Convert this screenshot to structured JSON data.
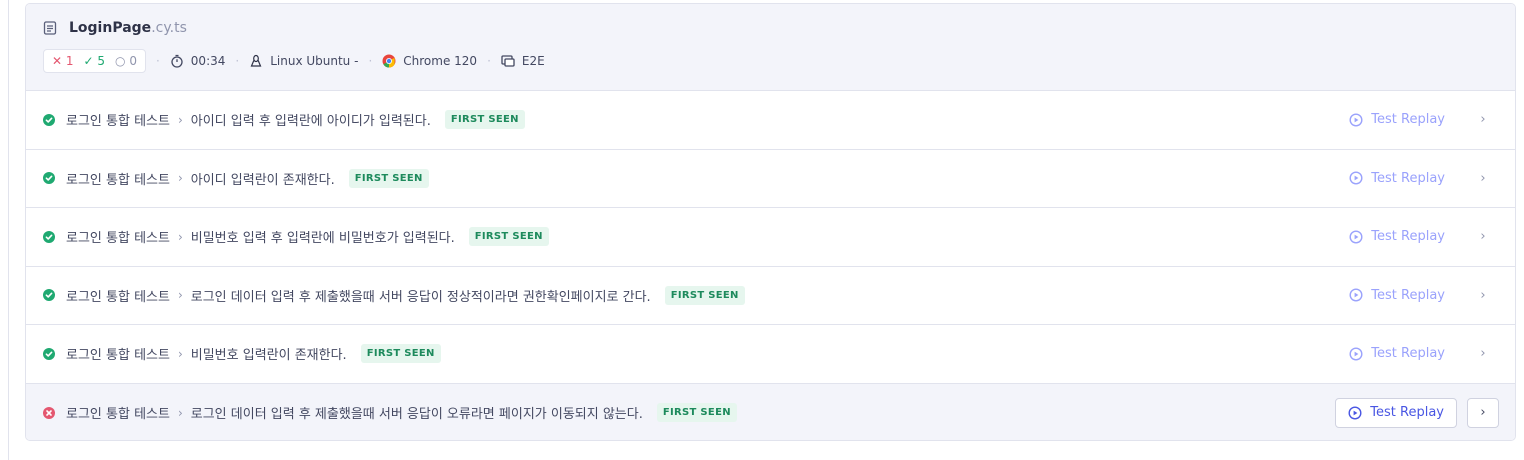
{
  "spec": {
    "name": "LoginPage",
    "ext": ".cy.ts",
    "counts": {
      "failed": "1",
      "passed": "5",
      "pending": "0"
    },
    "duration": "00:34",
    "os": "Linux Ubuntu -",
    "browser": "Chrome 120",
    "testing_type": "E2E"
  },
  "tests": [
    {
      "status": "passed",
      "suite": "로그인 통합 테스트",
      "title": "아이디 입력 후 입력란에 아이디가 입력된다.",
      "badge": "FIRST SEEN",
      "replay": "Test Replay"
    },
    {
      "status": "passed",
      "suite": "로그인 통합 테스트",
      "title": "아이디 입력란이 존재한다.",
      "badge": "FIRST SEEN",
      "replay": "Test Replay"
    },
    {
      "status": "passed",
      "suite": "로그인 통합 테스트",
      "title": "비밀번호 입력 후 입력란에 비밀번호가 입력된다.",
      "badge": "FIRST SEEN",
      "replay": "Test Replay"
    },
    {
      "status": "passed",
      "suite": "로그인 통합 테스트",
      "title": "로그인 데이터 입력 후 제출했을때 서버 응답이 정상적이라면 권한확인페이지로 간다.",
      "badge": "FIRST SEEN",
      "replay": "Test Replay"
    },
    {
      "status": "passed",
      "suite": "로그인 통합 테스트",
      "title": "비밀번호 입력란이 존재한다.",
      "badge": "FIRST SEEN",
      "replay": "Test Replay"
    },
    {
      "status": "failed",
      "suite": "로그인 통합 테스트",
      "title": "로그인 데이터 입력 후 제출했을때 서버 응답이 오류라면 페이지가 이동되지 않는다.",
      "badge": "FIRST SEEN",
      "replay": "Test Replay"
    }
  ],
  "icons": {
    "file": "file-icon",
    "timer": "stopwatch-icon",
    "os": "linux-icon",
    "browser": "chrome-icon",
    "testing_type": "e2e-icon",
    "pass": "check-circle-icon",
    "fail": "x-circle-icon",
    "replay": "replay-icon",
    "chevron": "chevron-right-icon"
  },
  "colors": {
    "passed": "#1fa971",
    "failed": "#e45770",
    "accent": "#4956e3",
    "badge_text": "#1d8a5c",
    "badge_bg": "#e6f6ee"
  }
}
